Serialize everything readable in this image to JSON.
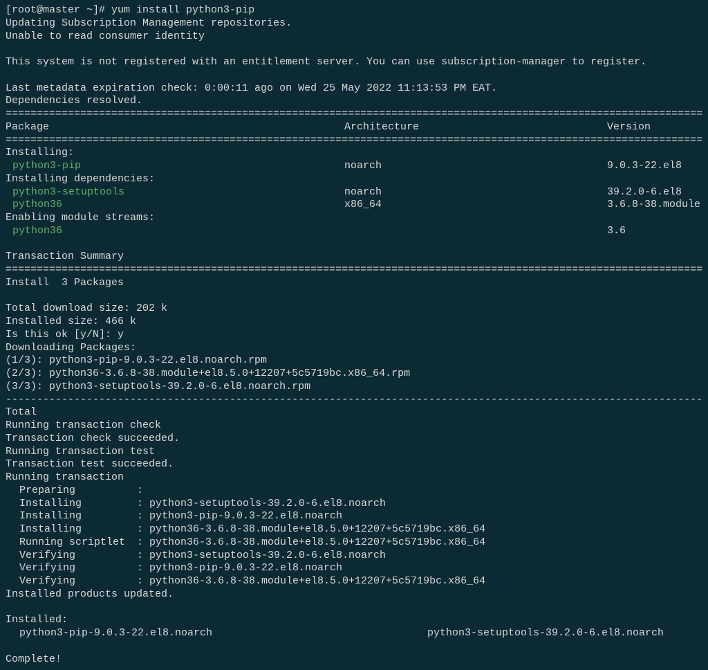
{
  "prompt": "[root@master ~]# ",
  "command": "yum install python3-pip",
  "lines": {
    "updating": "Updating Subscription Management repositories.",
    "unable": "Unable to read consumer identity",
    "notRegistered": "This system is not registered with an entitlement server. You can use subscription-manager to register.",
    "metadata": "Last metadata expiration check: 0:00:11 ago on Wed 25 May 2022 11:13:53 PM EAT.",
    "depsResolved": "Dependencies resolved."
  },
  "divider": "=========================================================================================================================",
  "dashDivider": "-------------------------------------------------------------------------------------------------------------------------",
  "headers": {
    "pkg": " Package",
    "arch": "Architecture",
    "ver": "Version"
  },
  "sections": {
    "installing": "Installing:",
    "installingDeps": "Installing dependencies:",
    "enabling": "Enabling module streams:"
  },
  "packages": {
    "pip": {
      "name": "python3-pip",
      "arch": "noarch",
      "ver": "9.0.3-22.el8"
    },
    "setuptools": {
      "name": "python3-setuptools",
      "arch": "noarch",
      "ver": "39.2.0-6.el8"
    },
    "python36": {
      "name": "python36",
      "arch": "x86_64",
      "ver": "3.6.8-38.module"
    },
    "stream": {
      "name": "python36",
      "arch": "",
      "ver": "3.6"
    }
  },
  "summary": {
    "title": "Transaction Summary",
    "install": "Install  3 Packages",
    "totalDl": "Total download size: 202 k",
    "installedSize": "Installed size: 466 k",
    "isOk": "Is this ok [y/N]: y",
    "dlPackages": "Downloading Packages:"
  },
  "downloads": [
    "(1/3): python3-pip-9.0.3-22.el8.noarch.rpm",
    "(2/3): python36-3.6.8-38.module+el8.5.0+12207+5c5719bc.x86_64.rpm",
    "(3/3): python3-setuptools-39.2.0-6.el8.noarch.rpm"
  ],
  "total": "Total",
  "transaction": {
    "runCheck": "Running transaction check",
    "checkOk": "Transaction check succeeded.",
    "runTest": "Running transaction test",
    "testOk": "Transaction test succeeded.",
    "running": "Running transaction"
  },
  "steps": [
    {
      "label": "Preparing",
      "val": ":"
    },
    {
      "label": "Installing",
      "val": ": python3-setuptools-39.2.0-6.el8.noarch"
    },
    {
      "label": "Installing",
      "val": ": python3-pip-9.0.3-22.el8.noarch"
    },
    {
      "label": "Installing",
      "val": ": python36-3.6.8-38.module+el8.5.0+12207+5c5719bc.x86_64"
    },
    {
      "label": "Running scriptlet",
      "val": ": python36-3.6.8-38.module+el8.5.0+12207+5c5719bc.x86_64"
    },
    {
      "label": "Verifying",
      "val": ": python3-setuptools-39.2.0-6.el8.noarch"
    },
    {
      "label": "Verifying",
      "val": ": python3-pip-9.0.3-22.el8.noarch"
    },
    {
      "label": "Verifying",
      "val": ": python36-3.6.8-38.module+el8.5.0+12207+5c5719bc.x86_64"
    }
  ],
  "productsUpdated": "Installed products updated.",
  "installedTitle": "Installed:",
  "installed": {
    "c1": "python3-pip-9.0.3-22.el8.noarch",
    "c2": "python3-setuptools-39.2.0-6.el8.noarch"
  },
  "complete": "Complete!"
}
